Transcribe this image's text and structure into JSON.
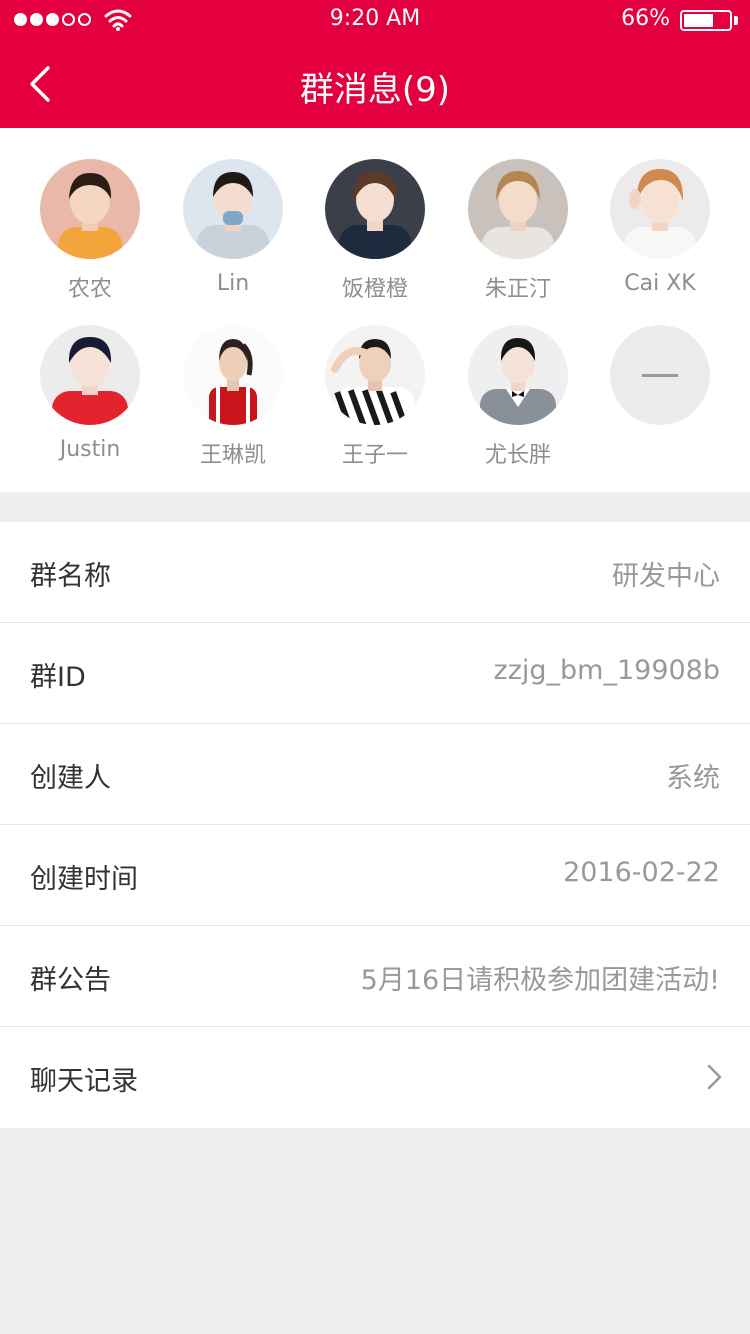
{
  "status_bar": {
    "time": "9:20 AM",
    "battery_percent": "66%",
    "battery_level": 0.66,
    "signal_icon": "signal-dots-icon",
    "wifi_icon": "wifi-icon"
  },
  "nav": {
    "title": "群消息(9)",
    "back_icon": "chevron-left-icon"
  },
  "members": [
    {
      "name": "农农"
    },
    {
      "name": "Lin"
    },
    {
      "name": "饭橙橙"
    },
    {
      "name": "朱正汀"
    },
    {
      "name": "Cai XK"
    },
    {
      "name": "Justin"
    },
    {
      "name": "王琳凯"
    },
    {
      "name": "王子一"
    },
    {
      "name": "尤长胖"
    }
  ],
  "remove_member_icon": "minus-icon",
  "info_rows": {
    "group_name": {
      "label": "群名称",
      "value": "研发中心"
    },
    "group_id": {
      "label": "群ID",
      "value": "zzjg_bm_19908b"
    },
    "creator": {
      "label": "创建人",
      "value": "系统"
    },
    "created_at": {
      "label": "创建时间",
      "value": "2016-02-22"
    },
    "announcement": {
      "label": "群公告",
      "value": "5月16日请积极参加团建活动!"
    },
    "chat_history": {
      "label": "聊天记录",
      "icon": "chevron-right-icon"
    }
  },
  "colors": {
    "brand": "#e4003f",
    "label_text": "#333333",
    "value_text": "#999999",
    "page_bg": "#efefef"
  }
}
